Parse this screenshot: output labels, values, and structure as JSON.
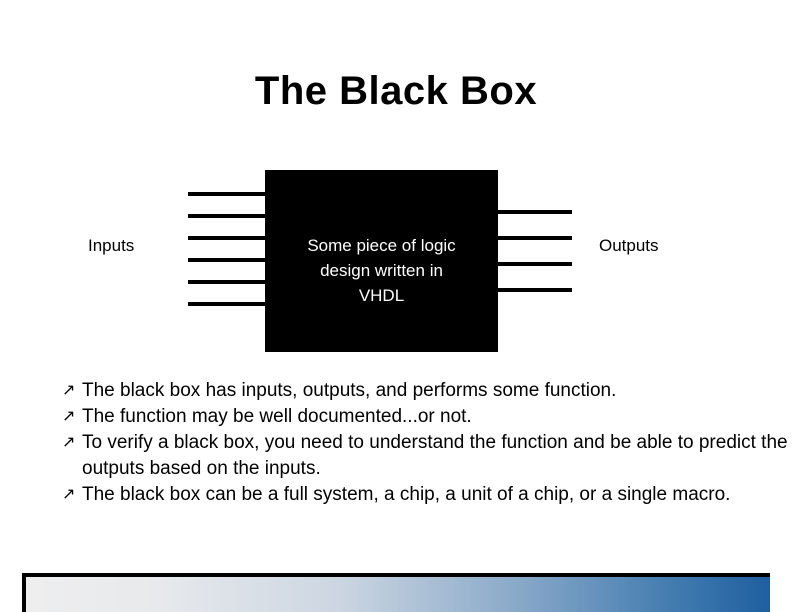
{
  "slide": {
    "title": "The Black Box"
  },
  "diagram": {
    "box_text": "Some piece of logic\ndesign written in\nVHDL",
    "inputs_label": "Inputs",
    "outputs_label": "Outputs",
    "input_wire_count": 6,
    "output_wire_count": 4,
    "box_fill_color": "#000000",
    "box_text_color": "#ffffff"
  },
  "bullets": {
    "marker": "↗",
    "items": [
      "The black box has inputs, outputs, and performs some function.",
      "The function may be well documented...or not.",
      "To verify a black box, you need to understand the function and be able to predict the outputs based on the inputs.",
      "The black box can be a full system, a chip, a unit of a chip, or a single macro."
    ]
  },
  "footer": {
    "gradient_start_color": "#eeeeee",
    "gradient_end_color": "#1f5fa0",
    "border_color": "#000000"
  }
}
